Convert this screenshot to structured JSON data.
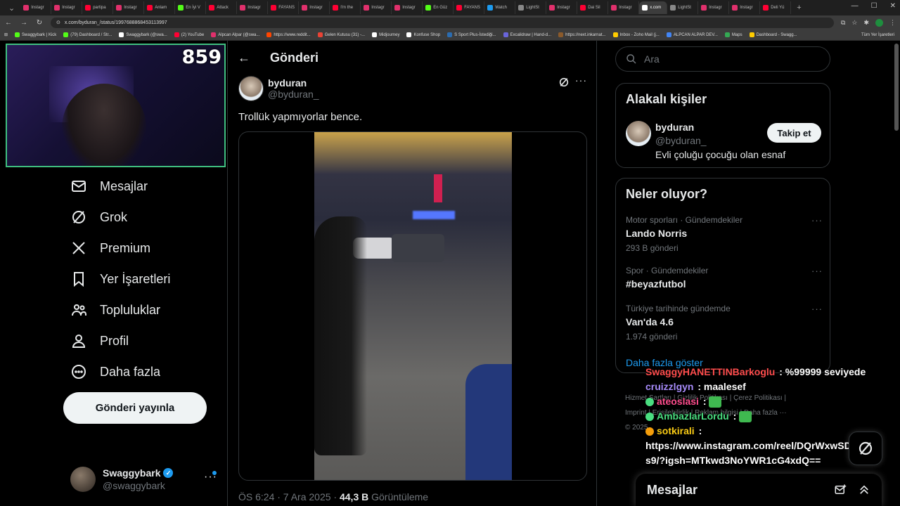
{
  "browser": {
    "tabs": [
      {
        "label": "Instagr",
        "color": "#e1306c"
      },
      {
        "label": "Instagr",
        "color": "#e1306c"
      },
      {
        "label": "partipa",
        "color": "#ff0033"
      },
      {
        "label": "Instagr",
        "color": "#e1306c"
      },
      {
        "label": "Anlam",
        "color": "#ff0033"
      },
      {
        "label": "En İyi V",
        "color": "#53fc18"
      },
      {
        "label": "Attack",
        "color": "#ff0033"
      },
      {
        "label": "Instagr",
        "color": "#e1306c"
      },
      {
        "label": "FAYANS",
        "color": "#ff0033"
      },
      {
        "label": "Instagr",
        "color": "#e1306c"
      },
      {
        "label": "I'm the",
        "color": "#ff0033"
      },
      {
        "label": "Instagr",
        "color": "#e1306c"
      },
      {
        "label": "Instagr",
        "color": "#e1306c"
      },
      {
        "label": "En Güz",
        "color": "#53fc18"
      },
      {
        "label": "FAYANS",
        "color": "#ff0033"
      },
      {
        "label": "Watch",
        "color": "#1d9bf0"
      },
      {
        "label": "LightSt",
        "color": "#888888"
      },
      {
        "label": "Instagr",
        "color": "#e1306c"
      },
      {
        "label": "Dai Sil",
        "color": "#ff0033"
      },
      {
        "label": "Instagr",
        "color": "#e1306c"
      },
      {
        "label": "x.com",
        "color": "#ffffff"
      },
      {
        "label": "LightSt",
        "color": "#888888"
      },
      {
        "label": "Instagr",
        "color": "#e1306c"
      },
      {
        "label": "Instagr",
        "color": "#e1306c"
      },
      {
        "label": "Deli Yü",
        "color": "#ff0033"
      }
    ],
    "url": "x.com/byduran_/status/1997688868453113997",
    "bookmarks": [
      {
        "label": "Swaggybark | Kick",
        "color": "#53fc18"
      },
      {
        "label": "(79) Dashboard / Str...",
        "color": "#53fc18"
      },
      {
        "label": "Swaggybark (@swa...",
        "color": "#ffffff"
      },
      {
        "label": "(2) YouTube",
        "color": "#ff0033"
      },
      {
        "label": "Alpcan Alpar (@swa...",
        "color": "#e1306c"
      },
      {
        "label": "https://www.reddit...",
        "color": "#ff4500"
      },
      {
        "label": "Gelen Kutusu (31) -...",
        "color": "#ea4335"
      },
      {
        "label": "Midjourney",
        "color": "#ffffff"
      },
      {
        "label": "Konfuse Shop",
        "color": "#ffffff"
      },
      {
        "label": "S Sport Plus-İstediği...",
        "color": "#2b6cb0"
      },
      {
        "label": "Excalidraw | Hand-d...",
        "color": "#6965db"
      },
      {
        "label": "https://next.inkarnat...",
        "color": "#8b5a2b"
      },
      {
        "label": "Inbox - Zoho Mail (j...",
        "color": "#ffcc00"
      },
      {
        "label": "ALPCAN ALPAR DEV...",
        "color": "#4285f4"
      },
      {
        "label": "Maps",
        "color": "#34a853"
      },
      {
        "label": "Dashboard - Swagg...",
        "color": "#ffcc00"
      }
    ],
    "bookmarks_right": "Tüm Yer İşaretleri"
  },
  "webcam": {
    "counter": "859"
  },
  "leftnav": {
    "items": [
      {
        "label": "Mesajlar",
        "icon": "mail-icon"
      },
      {
        "label": "Grok",
        "icon": "grok-icon"
      },
      {
        "label": "Premium",
        "icon": "x-logo-icon"
      },
      {
        "label": "Yer İşaretleri",
        "icon": "bookmark-icon"
      },
      {
        "label": "Topluluklar",
        "icon": "communities-icon"
      },
      {
        "label": "Profil",
        "icon": "profile-icon"
      },
      {
        "label": "Daha fazla",
        "icon": "more-circle-icon"
      }
    ],
    "post_button": "Gönderi yayınla",
    "account": {
      "name": "Swaggybark",
      "handle": "@swaggybark"
    }
  },
  "post": {
    "header": "Gönderi",
    "author_name": "byduran",
    "author_handle": "@byduran_",
    "text": "Trollük yapmıyorlar bence.",
    "time": "ÖS 6:24 · 7 Ara 2025 · ",
    "views": "44,3 B",
    "views_label": " Görüntüleme"
  },
  "sidebar": {
    "search_placeholder": "Ara",
    "related_title": "Alakalı kişiler",
    "related": {
      "name": "byduran",
      "handle": "@byduran_",
      "bio": "Evli çoluğu çocuğu olan esnaf",
      "follow": "Takip et"
    },
    "trends_title": "Neler oluyor?",
    "trends": [
      {
        "category": "Motor sporları · Gündemdekiler",
        "name": "Lando Norris",
        "count": "293 B gönderi"
      },
      {
        "category": "Spor · Gündemdekiler",
        "name": "#beyazfutbol",
        "count": ""
      },
      {
        "category": "Türkiye tarihinde gündemde",
        "name": "Van'da 4.6",
        "count": "1.974 gönderi"
      }
    ],
    "show_more": "Daha fazla göster",
    "footer": [
      "Hizmet Şartları",
      "Gizlilik Politikası",
      "Çerez Politikası",
      "Imprint",
      "Erişilebilirlik",
      "Reklam bilgisi",
      "Daha fazla ···",
      "© 2025"
    ]
  },
  "chat": [
    {
      "user": "SwaggyHANETTINBarkoglu",
      "msg": " : %99999 seviyede",
      "color": "#ff4d4d"
    },
    {
      "user": "cruizzlgyn",
      "msg": " : maalesef",
      "color": "#a78bfa"
    },
    {
      "user": "ateoslasi",
      "msg": " :",
      "color": "#ff4d8d"
    },
    {
      "user": "AmbazlarLordu",
      "msg": " :",
      "color": "#4ade80"
    },
    {
      "user": "sotkirali",
      "msg": " :",
      "color": "#facc15"
    }
  ],
  "chat_link": "https://www.instagram.com/reel/DQrWxwSDfs9/?igsh=MTkwd3NoYWR1cG4xdQ==",
  "messages_drawer": {
    "title": "Mesajlar"
  }
}
